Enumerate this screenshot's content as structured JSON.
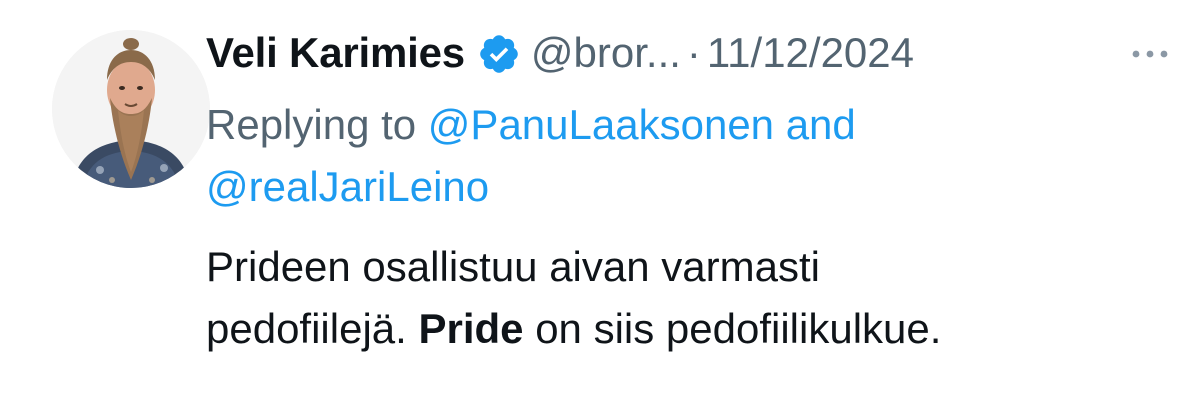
{
  "author": {
    "name": "Veli Karimies",
    "handle": "@bror...",
    "verified": true,
    "date": "11/12/2024"
  },
  "reply": {
    "prefix": "Replying to",
    "mention1": "@PanuLaaksonen",
    "conjunction": "and",
    "mention2": "@realJariLeino"
  },
  "body": {
    "line1": "Prideen osallistuu aivan varmasti",
    "line2_part1": "pedofiilejä.",
    "line2_bold": "Pride",
    "line2_part2": "on siis pedofiilikulkue."
  },
  "separator": "·",
  "icons": {
    "verified": "verified-badge-icon",
    "more": "more-options-icon"
  },
  "colors": {
    "link": "#1d9bf0",
    "muted": "#536471",
    "text": "#0f1419"
  }
}
